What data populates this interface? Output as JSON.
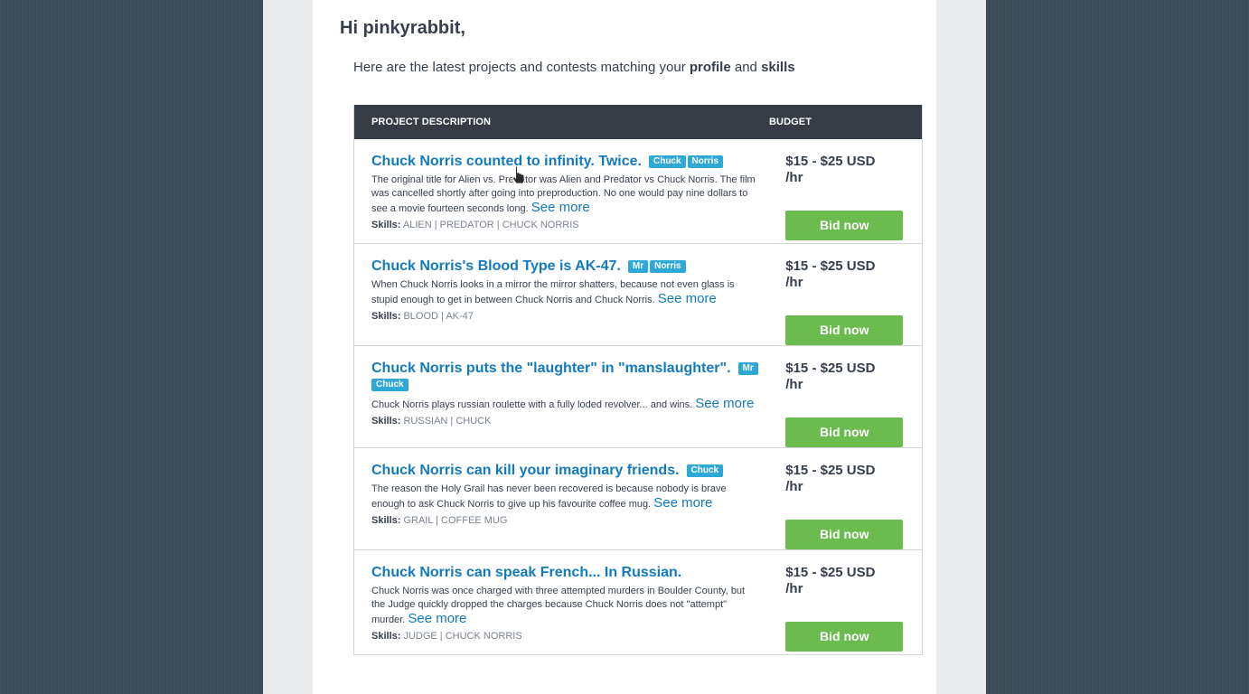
{
  "greeting": "Hi pinkyrabbit,",
  "intro": {
    "pre": "Here are the latest projects and contests matching your ",
    "profile": "profile",
    "and": " and ",
    "skills": "skills"
  },
  "table": {
    "col_description": "PROJECT DESCRIPTION",
    "col_budget": "BUDGET"
  },
  "skills_label": "Skills:",
  "see_more": "See more",
  "bid_label": "Bid now",
  "projects": [
    {
      "title": "Chuck Norris counted to infinity. Twice.",
      "tags": [
        "Chuck",
        "Norris"
      ],
      "description": "The original title for Alien vs. Predator was Alien and Predator vs Chuck Norris. The film was cancelled shortly after going into preproduction. No one would pay nine dollars to see a movie fourteen seconds long.",
      "skills": "ALIEN | PREDATOR | CHUCK NORRIS",
      "budget": "$15 - $25 USD /hr"
    },
    {
      "title": "Chuck Norris's Blood Type is AK-47.",
      "tags": [
        "Mr",
        "Norris"
      ],
      "description": "When Chuck Norris looks in a mirror the mirror shatters, because not even glass is stupid enough to get in between Chuck Norris and Chuck Norris.",
      "skills": "BLOOD | AK-47",
      "budget": "$15 - $25 USD /hr"
    },
    {
      "title": "Chuck Norris puts the \"laughter\" in \"manslaughter\".",
      "tags": [
        "Mr",
        "Chuck"
      ],
      "description": "Chuck Norris plays russian roulette with a fully loded revolver... and wins.",
      "skills": "RUSSIAN | CHUCK",
      "budget": "$15 - $25 USD /hr"
    },
    {
      "title": "Chuck Norris can kill your imaginary friends.",
      "tags": [
        "Chuck"
      ],
      "description": "The reason the Holy Grail has never been recovered is because nobody is brave enough to ask Chuck Norris to give up his favourite coffee mug.",
      "skills": "GRAIL | COFFEE MUG",
      "budget": "$15 - $25 USD /hr"
    },
    {
      "title": "Chuck Norris can speak French... In Russian.",
      "tags": [],
      "description": "Chuck Norris was once charged with three attempted murders in Boulder County, but the Judge quickly dropped the charges because Chuck Norris does not \"attempt\" murder.",
      "skills": "JUDGE | CHUCK NORRIS",
      "budget": "$15 - $25 USD /hr"
    }
  ],
  "colors": {
    "link": "#127ac1",
    "tag": "#2ea8d6",
    "bid": "#6cbb4f",
    "header": "#353c46"
  }
}
